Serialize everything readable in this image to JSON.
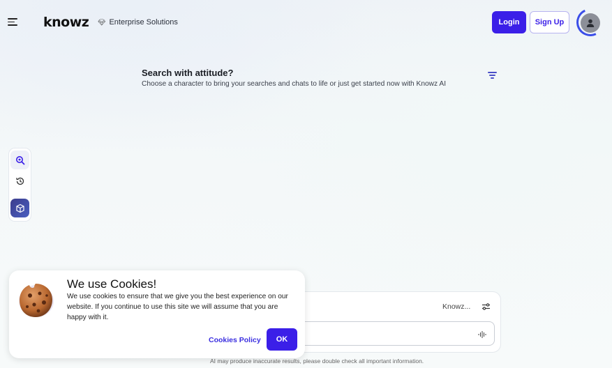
{
  "header": {
    "brand": "knowz",
    "enterprise_label": "Enterprise Solutions",
    "login_label": "Login",
    "signup_label": "Sign Up"
  },
  "hero": {
    "title": "Search with attitude?",
    "subtitle": "Choose a character to bring your searches and chats to life or just get started now with Knowz AI"
  },
  "sidebar": {
    "items": [
      {
        "icon": "search-ai-icon"
      },
      {
        "icon": "history-icon"
      },
      {
        "icon": "cube-icon"
      }
    ]
  },
  "chat": {
    "model_label": "Knowz...",
    "input_value": "",
    "disclaimer": "AI may produce inaccurate results, please double check all important information."
  },
  "cookie_banner": {
    "title": "We use Cookies!",
    "text": "We use cookies to ensure that we give you the best experience on our website. If you continue to use this site we will assume that you are happy with it.",
    "policy_label": "Cookies Policy",
    "ok_label": "OK"
  },
  "colors": {
    "accent": "#3b1fe8",
    "accent_light": "#b7b3f0"
  }
}
